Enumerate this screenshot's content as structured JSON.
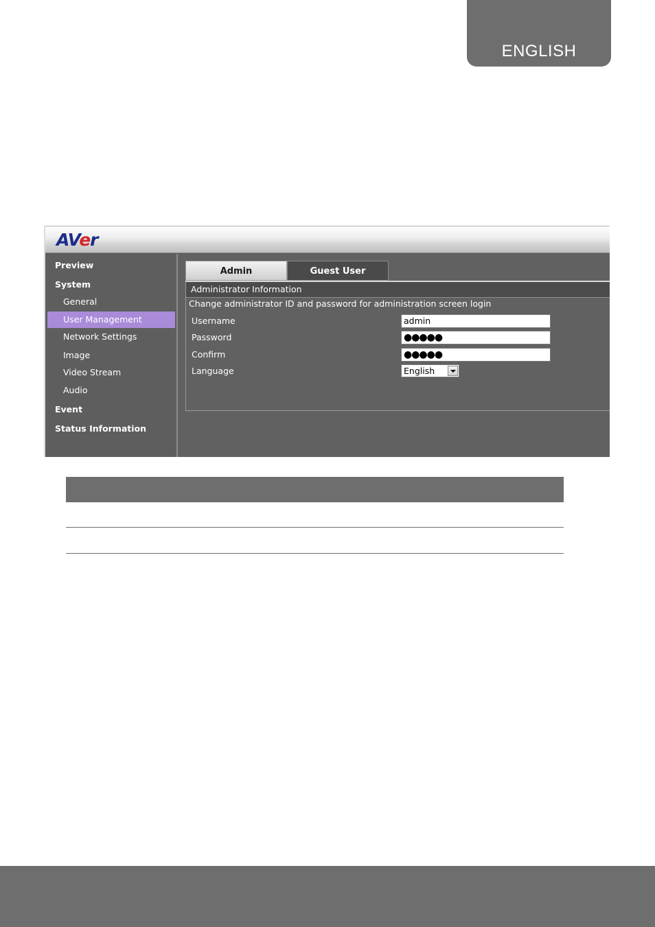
{
  "page_tab": {
    "label": "ENGLISH"
  },
  "app": {
    "logo": {
      "part1": "AV",
      "part2": "e",
      "part3": "r"
    },
    "sidebar": {
      "items": [
        {
          "label": "Preview"
        },
        {
          "label": "System"
        },
        {
          "label": "General"
        },
        {
          "label": "User Management"
        },
        {
          "label": "Network Settings"
        },
        {
          "label": "Image"
        },
        {
          "label": "Video Stream"
        },
        {
          "label": "Audio"
        },
        {
          "label": "Event"
        },
        {
          "label": "Status Information"
        }
      ],
      "active": "User Management"
    },
    "tabs": [
      {
        "label": "Admin"
      },
      {
        "label": "Guest User"
      }
    ],
    "panel": {
      "title": "Administrator Information",
      "description": "Change administrator ID and password for administration screen login",
      "fields": {
        "username": {
          "label": "Username",
          "value": "admin"
        },
        "password": {
          "label": "Password",
          "value": "●●●●●"
        },
        "confirm": {
          "label": "Confirm",
          "value": "●●●●●"
        },
        "language": {
          "label": "Language",
          "value": "English"
        }
      }
    },
    "colors": {
      "active_nav": "#a98bd9",
      "brand_blue": "#1b2d8a",
      "brand_red": "#d4262b"
    }
  }
}
